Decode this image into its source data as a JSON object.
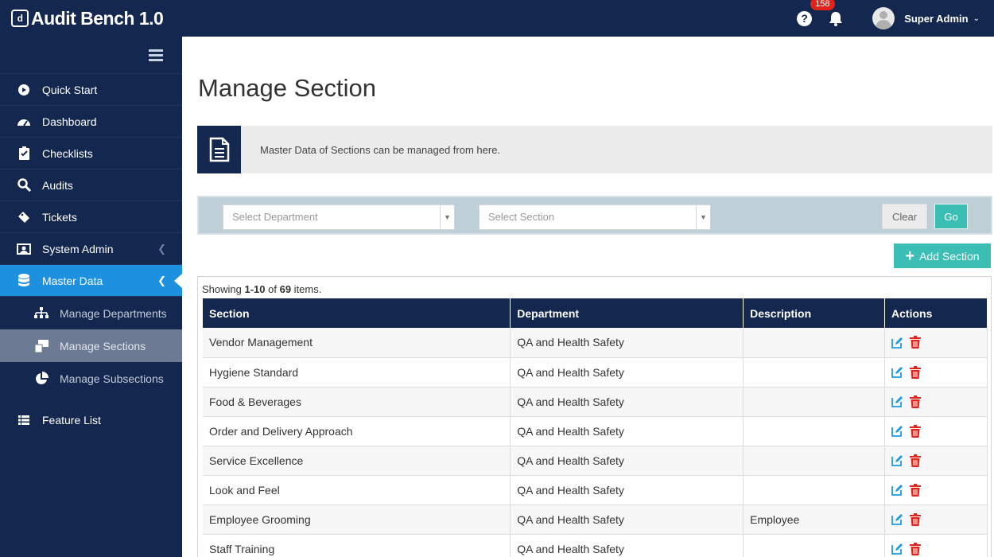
{
  "app": {
    "title": "Audit Bench 1.0"
  },
  "header": {
    "notification_count": "158",
    "user_name": "Super Admin"
  },
  "sidebar": {
    "items": [
      {
        "label": "Quick Start",
        "icon": "play-circle-icon"
      },
      {
        "label": "Dashboard",
        "icon": "gauge-icon"
      },
      {
        "label": "Checklists",
        "icon": "clipboard-icon"
      },
      {
        "label": "Audits",
        "icon": "search-audit-icon"
      },
      {
        "label": "Tickets",
        "icon": "ticket-icon"
      },
      {
        "label": "System Admin",
        "icon": "system-admin-icon"
      },
      {
        "label": "Master Data",
        "icon": "database-icon"
      }
    ],
    "sub_items": [
      {
        "label": "Manage Departments",
        "icon": "sitemap-icon"
      },
      {
        "label": "Manage Sections",
        "icon": "sections-icon"
      },
      {
        "label": "Manage Subsections",
        "icon": "pie-chart-icon"
      }
    ],
    "feature_list": {
      "label": "Feature List",
      "icon": "list-icon"
    }
  },
  "page": {
    "title": "Manage Section",
    "info_text": "Master Data of Sections can be managed from here."
  },
  "filters": {
    "department_placeholder": "Select Department",
    "section_placeholder": "Select Section",
    "clear_label": "Clear",
    "go_label": "Go"
  },
  "add_button": {
    "label": "Add Section"
  },
  "table": {
    "showing_prefix": "Showing ",
    "showing_range": "1-10",
    "showing_of": " of ",
    "showing_total": "69",
    "showing_suffix": " items.",
    "headers": [
      "Section",
      "Department",
      "Description",
      "Actions"
    ],
    "rows": [
      {
        "section": "Vendor Management",
        "department": "QA and Health Safety",
        "description": ""
      },
      {
        "section": "Hygiene Standard",
        "department": "QA and Health Safety",
        "description": ""
      },
      {
        "section": "Food & Beverages",
        "department": "QA and Health Safety",
        "description": ""
      },
      {
        "section": "Order and Delivery Approach",
        "department": "QA and Health Safety",
        "description": ""
      },
      {
        "section": "Service Excellence",
        "department": "QA and Health Safety",
        "description": ""
      },
      {
        "section": "Look and Feel",
        "department": "QA and Health Safety",
        "description": ""
      },
      {
        "section": "Employee Grooming",
        "department": "QA and Health Safety",
        "description": "Employee"
      },
      {
        "section": "Staff Training",
        "department": "QA and Health Safety",
        "description": ""
      }
    ]
  },
  "colors": {
    "navy": "#14274e",
    "active_blue": "#1e90e0",
    "teal": "#3bbfb4",
    "edit": "#1e9be0",
    "delete": "#e2231a"
  }
}
